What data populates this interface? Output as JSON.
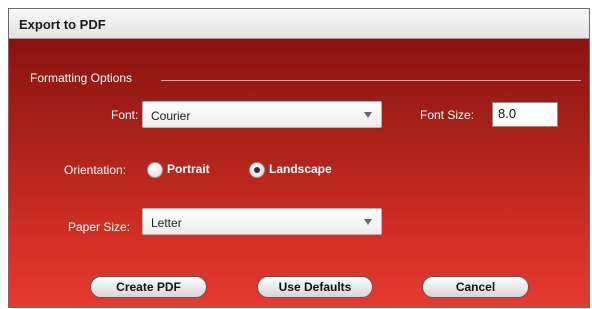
{
  "window": {
    "title": "Export to PDF"
  },
  "formatting": {
    "group_label": "Formatting Options",
    "font_label": "Font:",
    "font_value": "Courier",
    "font_size_label": "Font Size:",
    "font_size_value": "8.0",
    "orientation_label": "Orientation:",
    "orientation_options": [
      {
        "label": "Portrait",
        "selected": false
      },
      {
        "label": "Landscape",
        "selected": true
      }
    ],
    "paper_size_label": "Paper Size:",
    "paper_size_value": "Letter"
  },
  "buttons": {
    "create_pdf": "Create PDF",
    "use_defaults": "Use Defaults",
    "cancel": "Cancel"
  },
  "colors": {
    "panel_top": "#8a1310",
    "panel_bottom": "#e63a2e"
  }
}
